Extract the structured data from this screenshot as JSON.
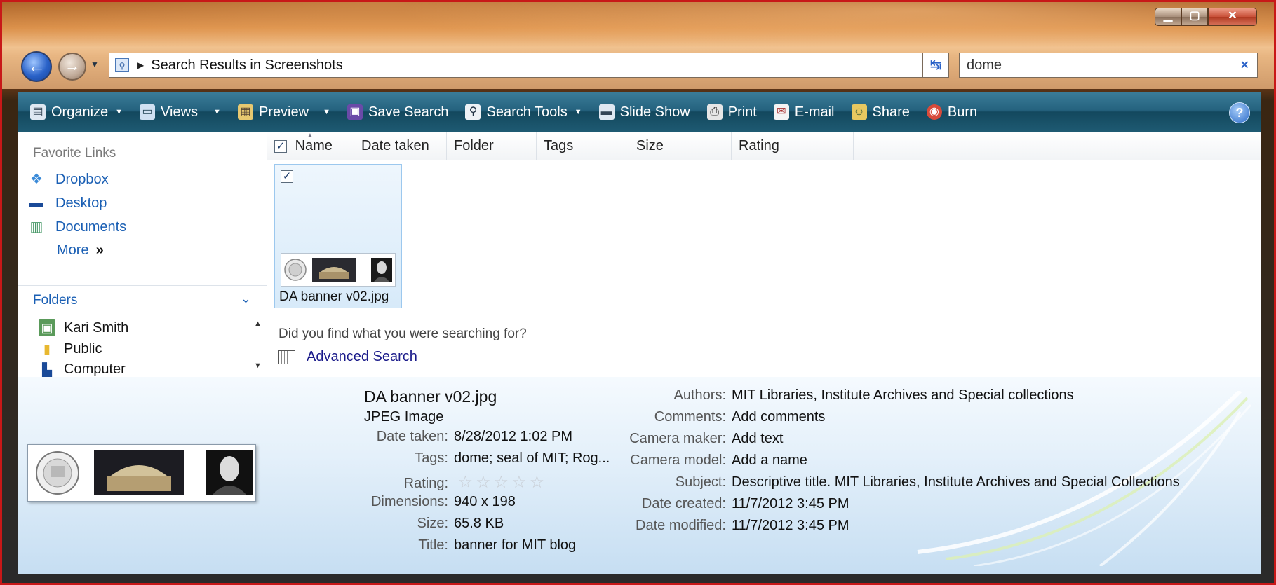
{
  "window": {
    "caption_buttons": {
      "minimize": "▁",
      "maximize": "▢",
      "close": "✕"
    }
  },
  "address_bar": {
    "path": "Search Results in Screenshots",
    "search_value": "dome",
    "search_clear": "×"
  },
  "toolbar": {
    "items": [
      {
        "label": "Organize",
        "icon": "organize-icon",
        "dropdown": true
      },
      {
        "label": "Views",
        "icon": "views-icon",
        "dropdown": true
      },
      {
        "label": "Preview",
        "icon": "preview-icon",
        "dropdown": true
      },
      {
        "label": "Save Search",
        "icon": "save-icon",
        "dropdown": false
      },
      {
        "label": "Search Tools",
        "icon": "search-tools-icon",
        "dropdown": true
      },
      {
        "label": "Slide Show",
        "icon": "slideshow-icon",
        "dropdown": false
      },
      {
        "label": "Print",
        "icon": "print-icon",
        "dropdown": false
      },
      {
        "label": "E-mail",
        "icon": "email-icon",
        "dropdown": false
      },
      {
        "label": "Share",
        "icon": "share-icon",
        "dropdown": false
      },
      {
        "label": "Burn",
        "icon": "burn-icon",
        "dropdown": false
      }
    ],
    "help": "?"
  },
  "navigation": {
    "favorite_links_title": "Favorite Links",
    "favorites": [
      {
        "label": "Dropbox",
        "icon": "dropbox-icon"
      },
      {
        "label": "Desktop",
        "icon": "desktop-icon"
      },
      {
        "label": "Documents",
        "icon": "documents-icon"
      }
    ],
    "more_label": "More",
    "folders_title": "Folders",
    "folders": [
      {
        "label": "Kari Smith",
        "icon": "user-folder-icon"
      },
      {
        "label": "Public",
        "icon": "folder-icon"
      },
      {
        "label": "Computer",
        "icon": "computer-icon"
      }
    ]
  },
  "file_list": {
    "columns": [
      "Name",
      "Date taken",
      "Folder",
      "Tags",
      "Size",
      "Rating"
    ],
    "items": [
      {
        "name": "DA banner v02.jpg",
        "checked": true
      }
    ],
    "search_prompt": "Did you find what you were searching for?",
    "advanced_search": "Advanced Search"
  },
  "details": {
    "filename": "DA banner v02.jpg",
    "filetype": "JPEG Image",
    "left_props": [
      {
        "key": "Date taken:",
        "value": "8/28/2012 1:02 PM"
      },
      {
        "key": "Tags:",
        "value": "dome; seal of MIT; Rog..."
      },
      {
        "key": "Rating:",
        "value": ""
      },
      {
        "key": "Dimensions:",
        "value": "940 x 198"
      },
      {
        "key": "Size:",
        "value": "65.8 KB"
      },
      {
        "key": "Title:",
        "value": "banner for MIT blog"
      }
    ],
    "rating_stars": 0,
    "right_props": [
      {
        "key": "Authors:",
        "value": "MIT Libraries, Institute Archives and Special collections"
      },
      {
        "key": "Comments:",
        "value": "Add comments"
      },
      {
        "key": "Camera maker:",
        "value": "Add text"
      },
      {
        "key": "Camera model:",
        "value": "Add a name"
      },
      {
        "key": "Subject:",
        "value": "Descriptive title. MIT Libraries, Institute Archives and Special Collections"
      },
      {
        "key": "Date created:",
        "value": "11/7/2012 3:45 PM"
      },
      {
        "key": "Date modified:",
        "value": "11/7/2012 3:45 PM"
      }
    ]
  }
}
